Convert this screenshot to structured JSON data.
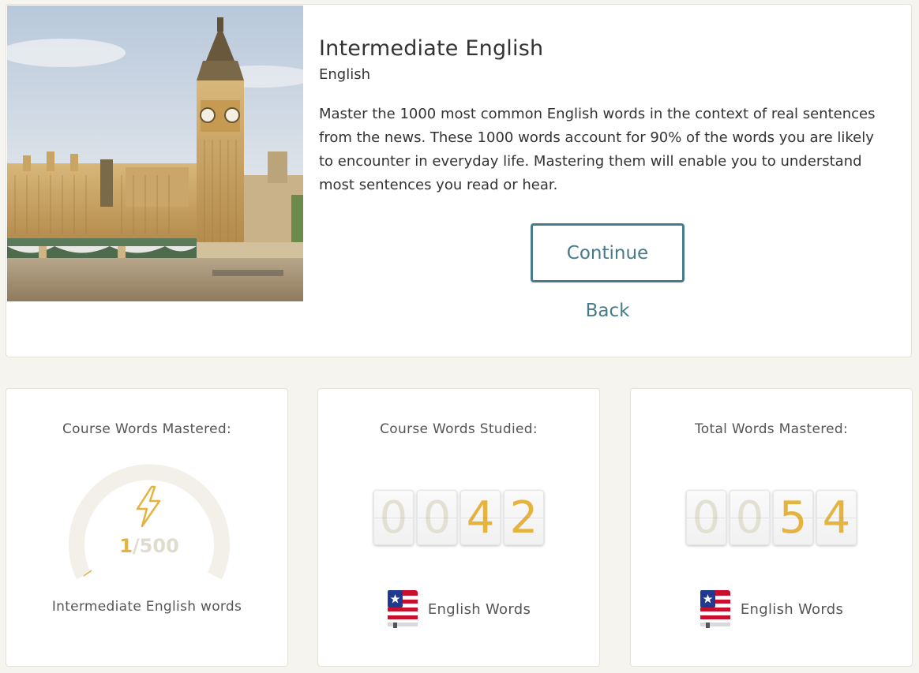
{
  "course": {
    "title": "Intermediate English",
    "language": "English",
    "description": "Master the 1000 most common English words in the context of real sentences from the news. These 1000 words account for 90% of the words you are likely to encounter in everyday life. Mastering them will enable you to understand most sentences you read or hear.",
    "continue_label": "Continue",
    "back_label": "Back",
    "image": "big-ben-london-photo"
  },
  "stats": {
    "mastered": {
      "title": "Course Words Mastered:",
      "current": "1",
      "total": "/500",
      "progress_fraction": 0.002,
      "icon": "lightning-icon",
      "caption": "Intermediate English words"
    },
    "studied": {
      "title": "Course Words Studied:",
      "digits": [
        "0",
        "0",
        "4",
        "2"
      ],
      "label": "English Words",
      "icon": "us-flag-book-icon"
    },
    "total": {
      "title": "Total Words Mastered:",
      "digits": [
        "0",
        "0",
        "5",
        "4"
      ],
      "label": "English Words",
      "icon": "us-flag-book-icon"
    }
  },
  "colors": {
    "accent": "#477a8c",
    "gold": "#e5b440",
    "background": "#f5f4ef"
  }
}
